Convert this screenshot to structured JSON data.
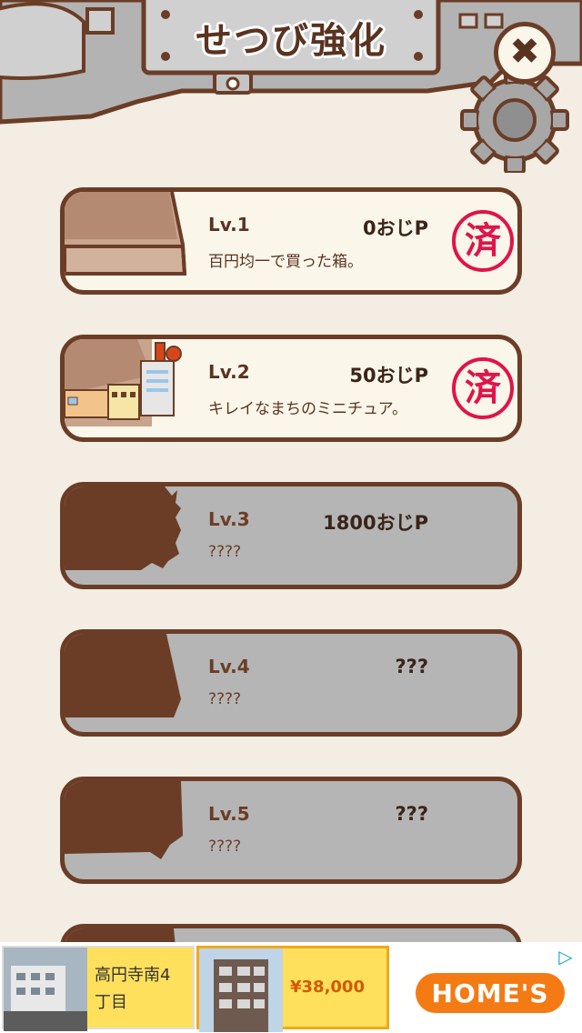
{
  "header": {
    "title": "せつび強化",
    "close_icon": "close-icon"
  },
  "upgrades": [
    {
      "level": "Lv.1",
      "cost": "0おじP",
      "desc": "百円均一で買った箱。",
      "state": "purchased",
      "stamp": "済"
    },
    {
      "level": "Lv.2",
      "cost": "50おじP",
      "desc": "キレイなまちのミニチュア。",
      "state": "purchased",
      "stamp": "済"
    },
    {
      "level": "Lv.3",
      "cost": "1800おじP",
      "desc": "????",
      "state": "locked"
    },
    {
      "level": "Lv.4",
      "cost": "???",
      "desc": "????",
      "state": "locked"
    },
    {
      "level": "Lv.5",
      "cost": "???",
      "desc": "????",
      "state": "locked"
    }
  ],
  "ad": {
    "listing_a": {
      "text": "高円寺南4丁目"
    },
    "listing_b": {
      "price": "¥38,000"
    },
    "brand": "HOME'S",
    "choice_icon": "ad-choices-icon"
  },
  "colors": {
    "background": "#f3ede4",
    "outline": "#6b3d26",
    "card_unlocked": "#fbf6ea",
    "card_locked": "#b5b5b5",
    "stamp": "#e0134a",
    "brand_orange": "#f47a14",
    "ad_yellow": "#ffe05c"
  }
}
